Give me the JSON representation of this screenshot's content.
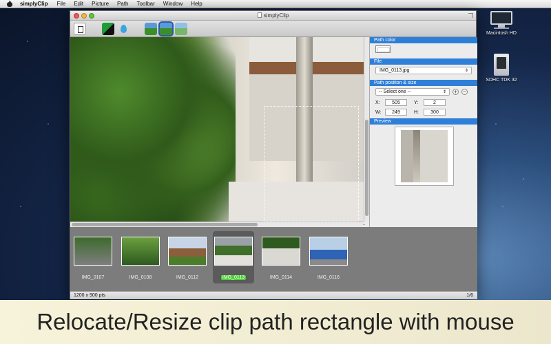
{
  "menubar": {
    "app_name": "simplyClip",
    "items": [
      "File",
      "Edit",
      "Picture",
      "Path",
      "Toolbar",
      "Window",
      "Help"
    ]
  },
  "desktop": {
    "icons": [
      {
        "label": "Macintosh HD",
        "icon": "hard-drive-icon"
      },
      {
        "label": "SDHC TDK 32",
        "icon": "sd-card-icon"
      }
    ]
  },
  "window": {
    "title": "simplyClip",
    "toolbar": {
      "buttons": [
        "clip-icon",
        "fill-icon",
        "drop-icon",
        "image-icon",
        "image-selected-icon",
        "image-light-icon"
      ]
    },
    "panel": {
      "path_color_title": "Path color",
      "file_title": "File",
      "file_value": "IMG_0113.jpg",
      "position_title": "Path position & size",
      "position_select": "-- Select one --",
      "fields": {
        "x_label": "X:",
        "x": "505",
        "y_label": "Y:",
        "y": "2",
        "w_label": "W:",
        "w": "249",
        "h_label": "H:",
        "h": "300"
      },
      "preview_title": "Preview"
    },
    "thumbnails": [
      {
        "name": "IMG_0107"
      },
      {
        "name": "IMG_0108"
      },
      {
        "name": "IMG_0112"
      },
      {
        "name": "IMG_0113",
        "selected": true
      },
      {
        "name": "IMG_0114"
      },
      {
        "name": "IMG_0116"
      }
    ],
    "status": {
      "dimensions": "1200 x 900 pts",
      "page": "1/6"
    }
  },
  "caption": "Relocate/Resize clip path rectangle with mouse",
  "colors": {
    "accent": "#2e7fd8",
    "selected_label": "#4fcf3a"
  }
}
